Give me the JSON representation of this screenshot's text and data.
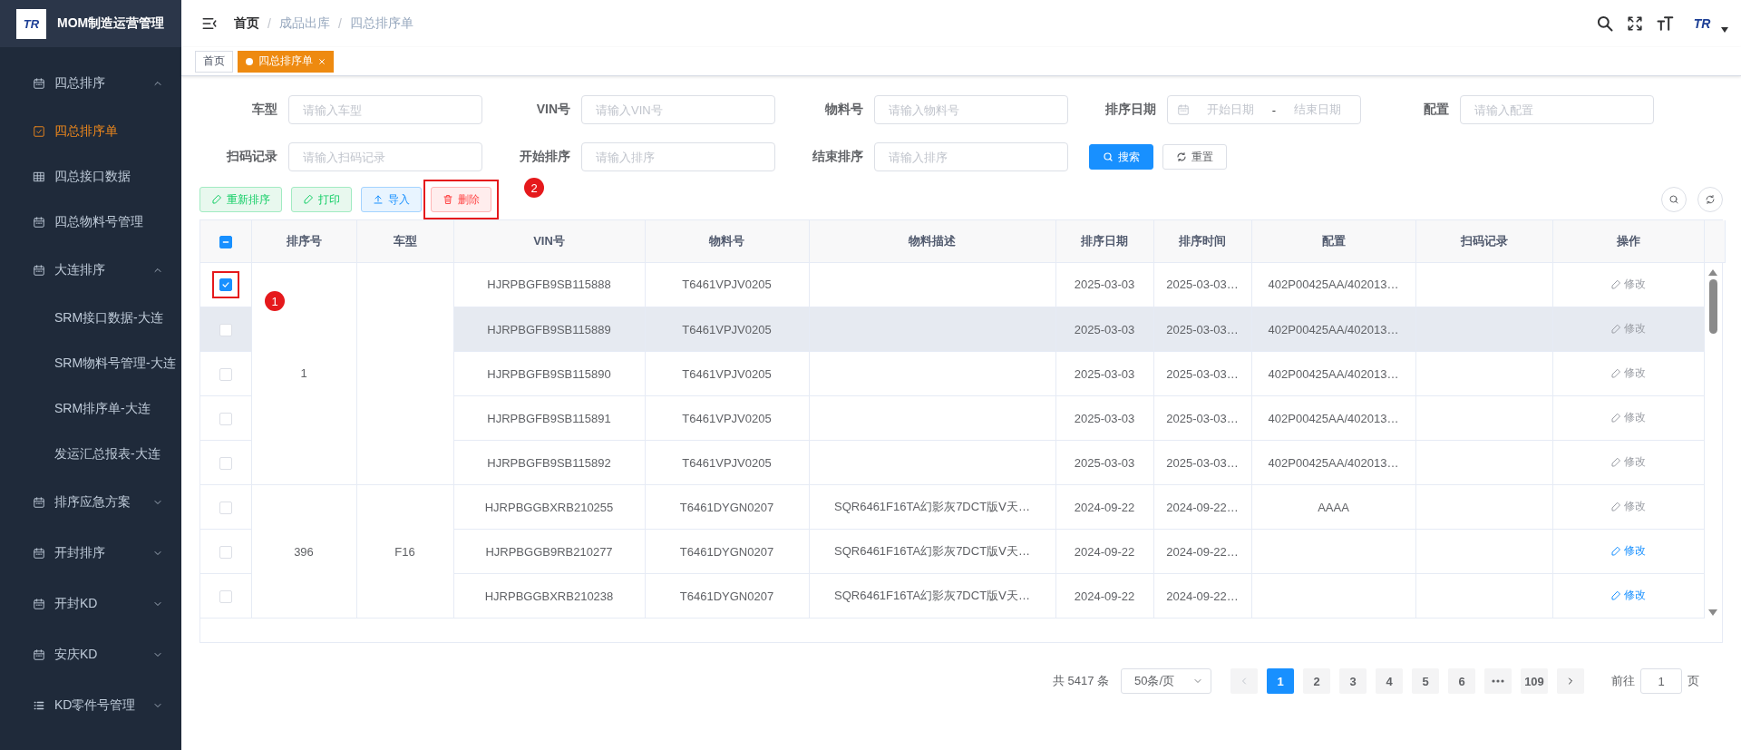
{
  "brand": {
    "logo_text": "TR",
    "title": "MOM制造运营管理"
  },
  "sidebar": {
    "groups": [
      {
        "label": "四总排序",
        "expanded": true,
        "children": [
          {
            "label": "四总排序单",
            "selected": true
          },
          {
            "label": "四总接口数据",
            "selected": false
          },
          {
            "label": "四总物料号管理",
            "selected": false
          }
        ]
      },
      {
        "label": "大连排序",
        "expanded": true,
        "children": [
          {
            "label": "SRM接口数据-大连",
            "selected": false
          },
          {
            "label": "SRM物料号管理-大连",
            "selected": false
          },
          {
            "label": "SRM排序单-大连",
            "selected": false
          },
          {
            "label": "发运汇总报表-大连",
            "selected": false
          }
        ]
      },
      {
        "label": "排序应急方案",
        "expanded": false
      },
      {
        "label": "开封排序",
        "expanded": false
      },
      {
        "label": "开封KD",
        "expanded": false
      },
      {
        "label": "安庆KD",
        "expanded": false
      },
      {
        "label": "KD零件号管理",
        "expanded": false
      }
    ]
  },
  "breadcrumb": [
    "首页",
    "成品出库",
    "四总排序单"
  ],
  "breadcrumb_separator": "/",
  "header": {
    "avatar_text": "TR"
  },
  "tags": [
    {
      "label": "首页",
      "selected": false
    },
    {
      "label": "四总排序单",
      "selected": true
    }
  ],
  "filters": [
    {
      "kind": "text",
      "label": "车型",
      "placeholder": "请输入车型"
    },
    {
      "kind": "text",
      "label": "VIN号",
      "placeholder": "请输入VIN号"
    },
    {
      "kind": "text",
      "label": "物料号",
      "placeholder": "请输入物料号"
    },
    {
      "kind": "date-range",
      "label": "排序日期",
      "start_placeholder": "开始日期",
      "separator": "-",
      "end_placeholder": "结束日期"
    },
    {
      "kind": "text",
      "label": "配置",
      "placeholder": "请输入配置"
    },
    {
      "kind": "text",
      "label": "扫码记录",
      "placeholder": "请输入扫码记录"
    },
    {
      "kind": "text",
      "label": "开始排序",
      "placeholder": "请输入排序"
    },
    {
      "kind": "text",
      "label": "结束排序",
      "placeholder": "请输入排序"
    }
  ],
  "filter_buttons": [
    {
      "kind": "search",
      "label": "搜索"
    },
    {
      "kind": "reset",
      "label": "重置"
    }
  ],
  "toolbar": [
    {
      "kind": "success",
      "label": "重新排序",
      "highlighted": false
    },
    {
      "kind": "success",
      "label": "打印",
      "highlighted": false
    },
    {
      "kind": "info",
      "label": "导入",
      "highlighted": false
    },
    {
      "kind": "danger",
      "label": "删除",
      "highlighted": true
    }
  ],
  "annotations": [
    {
      "label": "1"
    },
    {
      "label": "2"
    }
  ],
  "table": {
    "columns": [
      "排序号",
      "车型",
      "VIN号",
      "物料号",
      "物料描述",
      "排序日期",
      "排序时间",
      "配置",
      "扫码记录",
      "操作"
    ],
    "header_indeterminate": true,
    "groups": [
      {
        "sort_no": "1",
        "rows": [
          {
            "checked": true,
            "highlighted": true,
            "hovered": false,
            "vin": "HJRPBGFB9SB115888",
            "material": "T6461VPJV0205",
            "desc": "",
            "date": "2025-03-03",
            "time": "2025-03-03…",
            "config": "402P00425AA/402013…",
            "scan": "",
            "action": "修改",
            "disabled": true
          },
          {
            "checked": false,
            "highlighted": false,
            "hovered": true,
            "vin": "HJRPBGFB9SB115889",
            "material": "T6461VPJV0205",
            "desc": "",
            "date": "2025-03-03",
            "time": "2025-03-03…",
            "config": "402P00425AA/402013…",
            "scan": "",
            "action": "修改",
            "disabled": true
          },
          {
            "checked": false,
            "highlighted": false,
            "hovered": false,
            "vin": "HJRPBGFB9SB115890",
            "material": "T6461VPJV0205",
            "desc": "",
            "date": "2025-03-03",
            "time": "2025-03-03…",
            "config": "402P00425AA/402013…",
            "scan": "",
            "action": "修改",
            "disabled": true
          },
          {
            "checked": false,
            "highlighted": false,
            "hovered": false,
            "vin": "HJRPBGFB9SB115891",
            "material": "T6461VPJV0205",
            "desc": "",
            "date": "2025-03-03",
            "time": "2025-03-03…",
            "config": "402P00425AA/402013…",
            "scan": "",
            "action": "修改",
            "disabled": true
          },
          {
            "checked": false,
            "highlighted": false,
            "hovered": false,
            "vin": "HJRPBGFB9SB115892",
            "material": "T6461VPJV0205",
            "desc": "",
            "date": "2025-03-03",
            "time": "2025-03-03…",
            "config": "402P00425AA/402013…",
            "scan": "",
            "action": "修改",
            "disabled": true
          }
        ]
      },
      {
        "sort_no": "396",
        "model": "F16",
        "rows": [
          {
            "checked": false,
            "highlighted": false,
            "hovered": false,
            "vin": "HJRPBGGBXRB210255",
            "material": "T6461DYGN0207",
            "desc": "SQR6461F16TA幻影灰7DCT版Ⅴ天…",
            "date": "2024-09-22",
            "time": "2024-09-22…",
            "config": "AAAA",
            "scan": "",
            "action": "修改",
            "disabled": true
          },
          {
            "checked": false,
            "highlighted": false,
            "hovered": false,
            "vin": "HJRPBGGB9RB210277",
            "material": "T6461DYGN0207",
            "desc": "SQR6461F16TA幻影灰7DCT版Ⅴ天…",
            "date": "2024-09-22",
            "time": "2024-09-22…",
            "config": "",
            "scan": "",
            "action": "修改",
            "disabled": false
          },
          {
            "checked": false,
            "highlighted": false,
            "hovered": false,
            "vin": "HJRPBGGBXRB210238",
            "material": "T6461DYGN0207",
            "desc": "SQR6461F16TA幻影灰7DCT版Ⅴ天…",
            "date": "2024-09-22",
            "time": "2024-09-22…",
            "config": "",
            "scan": "",
            "action": "修改",
            "disabled": false
          }
        ]
      }
    ]
  },
  "pagination": {
    "total": "共 5417 条",
    "page_size": "50条/页",
    "pages": [
      {
        "kind": "page",
        "label": "1",
        "selected": true
      },
      {
        "kind": "page",
        "label": "2",
        "selected": false
      },
      {
        "kind": "page",
        "label": "3",
        "selected": false
      },
      {
        "kind": "page",
        "label": "4",
        "selected": false
      },
      {
        "kind": "page",
        "label": "5",
        "selected": false
      },
      {
        "kind": "page",
        "label": "6",
        "selected": false
      },
      {
        "kind": "more",
        "selected": false
      },
      {
        "kind": "page",
        "label": "109",
        "selected": false
      }
    ],
    "goto_label": "前往",
    "goto_value": "1",
    "goto_suffix": "页"
  }
}
